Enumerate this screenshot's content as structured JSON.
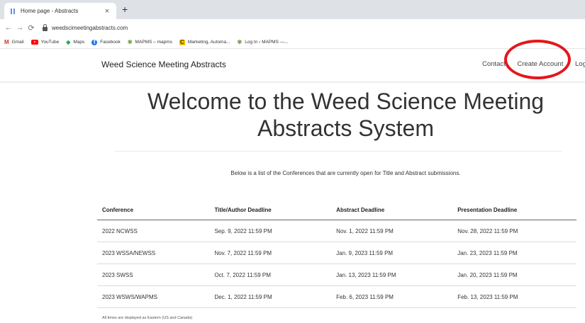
{
  "browser": {
    "tab_title": "Home page - Abstracts",
    "tab_close": "×",
    "new_tab": "+",
    "url": "weedscimeetingabstracts.com",
    "bookmarks": [
      {
        "label": "Gmail",
        "icon": "gmail-icon"
      },
      {
        "label": "YouTube",
        "icon": "youtube-icon"
      },
      {
        "label": "Maps",
        "icon": "maps-icon"
      },
      {
        "label": "Facebook",
        "icon": "facebook-icon"
      },
      {
        "label": "MAPMS – mapms",
        "icon": "mapms-icon"
      },
      {
        "label": "Marketing, Automa...",
        "icon": "marketing-icon"
      },
      {
        "label": "Log In ‹ MAPMS —...",
        "icon": "mapms-icon"
      }
    ]
  },
  "site": {
    "brand": "Weed Science Meeting Abstracts",
    "nav": {
      "contact": "Contact",
      "create_account": "Create Account",
      "login": "Login"
    },
    "highlight_color": "#e4171b"
  },
  "main": {
    "heading": "Welcome to the Weed Science Meeting Abstracts System",
    "intro": "Below is a list of the Conferences that are currently open for Title and Abstract submissions.",
    "table": {
      "headers": [
        "Conference",
        "Title/Author Deadline",
        "Abstract Deadline",
        "Presentation Deadline"
      ],
      "rows": [
        [
          "2022 NCWSS",
          "Sep. 9, 2022 11:59 PM",
          "Nov. 1, 2022 11:59 PM",
          "Nov. 28, 2022 11:59 PM"
        ],
        [
          "2023 WSSA/NEWSS",
          "Nov. 7, 2022 11:59 PM",
          "Jan. 9, 2023 11:59 PM",
          "Jan. 23, 2023 11:59 PM"
        ],
        [
          "2023 SWSS",
          "Oct. 7, 2022 11:59 PM",
          "Jan. 13, 2023 11:59 PM",
          "Jan. 20, 2023 11:59 PM"
        ],
        [
          "2023 WSWS/WAPMS",
          "Dec. 1, 2022 11:59 PM",
          "Feb. 6, 2023 11:59 PM",
          "Feb. 13, 2023 11:59 PM"
        ]
      ]
    },
    "footnote": "All times are displayed as Eastern (US and Canada)"
  }
}
